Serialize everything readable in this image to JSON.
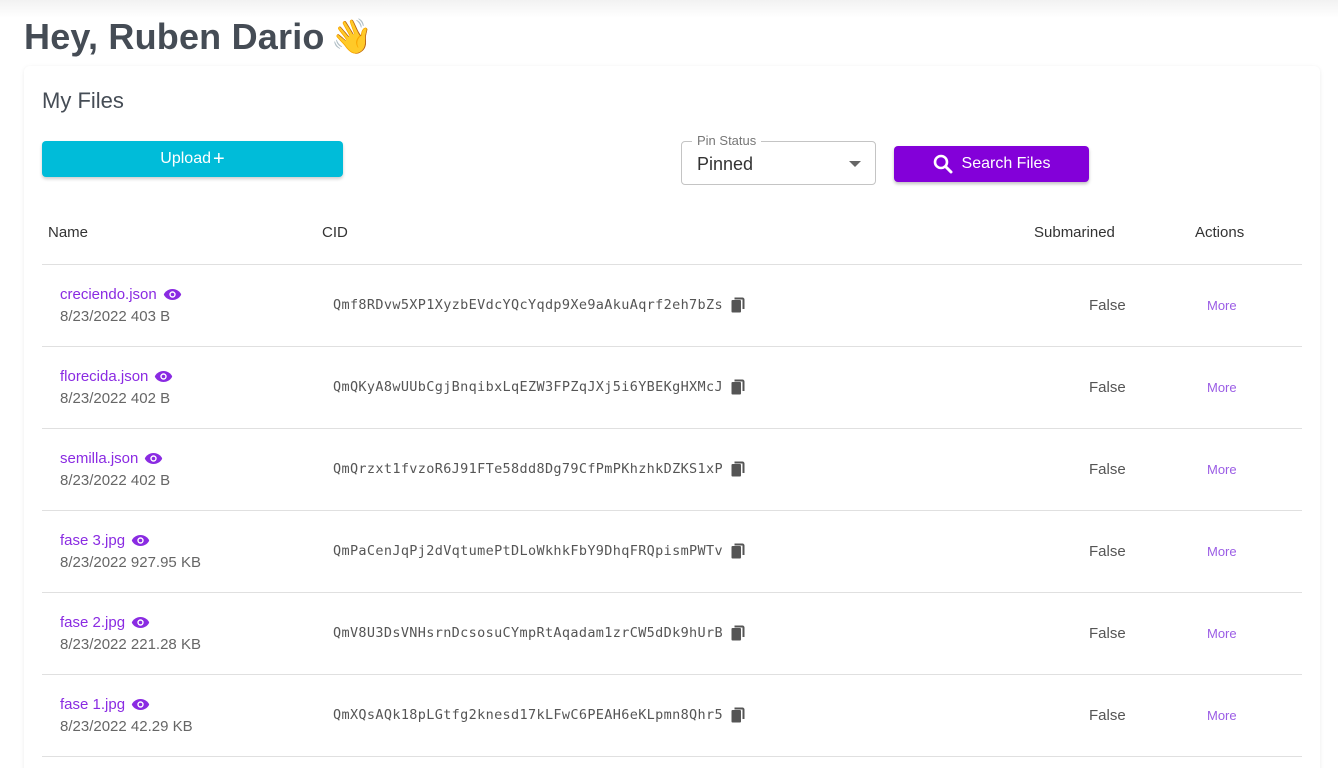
{
  "greeting": {
    "text": "Hey, Ruben Dario",
    "emoji": "👋"
  },
  "card": {
    "title": "My Files"
  },
  "upload_button": {
    "label": "Upload",
    "icon": "plus-icon"
  },
  "pin_status": {
    "legend": "Pin Status",
    "selected": "Pinned"
  },
  "search_button": {
    "label": "Search Files",
    "icon": "search-icon"
  },
  "colors": {
    "upload": "#00bcd9",
    "search": "#8300d9",
    "link": "#8a2be2"
  },
  "table": {
    "headers": {
      "name": "Name",
      "cid": "CID",
      "submarined": "Submarined",
      "actions": "Actions"
    },
    "rows": [
      {
        "name": "creciendo.json",
        "meta": "8/23/2022 403 B",
        "cid": "Qmf8RDvw5XP1XyzbEVdcYQcYqdp9Xe9aAkuAqrf2eh7bZs",
        "submarined": "False",
        "action": "More"
      },
      {
        "name": "florecida.json",
        "meta": "8/23/2022 402 B",
        "cid": "QmQKyA8wUUbCgjBnqibxLqEZW3FPZqJXj5i6YBEKgHXMcJ",
        "submarined": "False",
        "action": "More"
      },
      {
        "name": "semilla.json",
        "meta": "8/23/2022 402 B",
        "cid": "QmQrzxt1fvzoR6J91FTe58dd8Dg79CfPmPKhzhkDZKS1xP",
        "submarined": "False",
        "action": "More"
      },
      {
        "name": "fase 3.jpg",
        "meta": "8/23/2022 927.95 KB",
        "cid": "QmPaCenJqPj2dVqtumePtDLoWkhkFbY9DhqFRQpismPWTv",
        "submarined": "False",
        "action": "More"
      },
      {
        "name": "fase 2.jpg",
        "meta": "8/23/2022 221.28 KB",
        "cid": "QmV8U3DsVNHsrnDcsosuCYmpRtAqadam1zrCW5dDk9hUrB",
        "submarined": "False",
        "action": "More"
      },
      {
        "name": "fase 1.jpg",
        "meta": "8/23/2022 42.29 KB",
        "cid": "QmXQsAQk18pLGtfg2knesd17kLFwC6PEAH6eKLpmn8Qhr5",
        "submarined": "False",
        "action": "More"
      }
    ]
  }
}
